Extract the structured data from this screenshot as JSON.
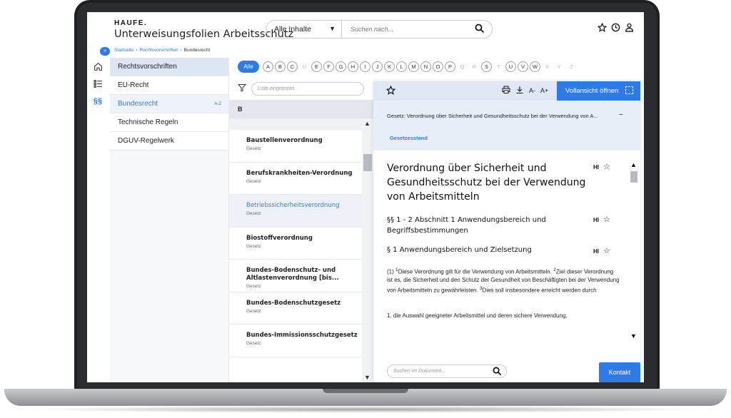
{
  "header": {
    "logo": "HAUFE.",
    "app_title": "Unterweisungsfolien Arbeitsschutz",
    "scope_select": "Alle Inhalte",
    "search_placeholder": "Suchen nach..."
  },
  "breadcrumb": [
    "Startseite",
    "Rechtsvorschriften",
    "Bundesrecht"
  ],
  "nav": {
    "heading": "Rechtsvorschriften",
    "items": [
      {
        "label": "EU-Recht"
      },
      {
        "label": "Bundesrecht",
        "badge": "A-Z"
      },
      {
        "label": "Technische Regeln"
      },
      {
        "label": "DGUV-Regelwerk"
      }
    ]
  },
  "alphabet": {
    "all_label": "Alle",
    "letters": [
      "A",
      "B",
      "C",
      "D",
      "E",
      "F",
      "G",
      "H",
      "I",
      "J",
      "K",
      "L",
      "M",
      "N",
      "O",
      "P",
      "Q",
      "R",
      "S",
      "T",
      "U",
      "V",
      "W",
      "X",
      "Y",
      "Z"
    ],
    "disabled": [
      "D",
      "Q",
      "R",
      "T",
      "X",
      "Y",
      "Z"
    ]
  },
  "list": {
    "filter_placeholder": "Liste eingrenzen",
    "section": "B",
    "laws": [
      {
        "name": "Baustellenverordnung",
        "type": "Gesetz"
      },
      {
        "name": "Berufskrankheiten-Verordnung",
        "type": "Gesetz"
      },
      {
        "name": "Betriebssicherheitsverordnung",
        "type": "Gesetz"
      },
      {
        "name": "Biostoffverordnung",
        "type": "Gesetz"
      },
      {
        "name": "Bundes-Bodenschutz- und Altlastenverordnung [bis...",
        "type": "Gesetz"
      },
      {
        "name": "Bundes-Bodenschutzgesetz",
        "type": "Gesetz"
      },
      {
        "name": "Bundes-Immissionsschutzgesetz",
        "type": "Gesetz"
      }
    ]
  },
  "doc": {
    "full_view_label": "Vollansicht öffnen",
    "font_down": "A-",
    "font_up": "A+",
    "law_line": "Gesetz: Verordnung über Sicherheit und Gesundheitsschutz bei der Verwendung von A...",
    "status_link": "Gesetzesstand",
    "title": "Verordnung über Sicherheit und Gesundheitsschutz bei der Verwendung von Arbeitsmitteln",
    "hi_label": "HI",
    "section1": "§§ 1 - 2 Abschnitt 1 Anwendungsbereich und Begriffsbestimmungen",
    "section2": "§ 1 Anwendungsbereich und Zielsetzung",
    "para_lead": "(1) ",
    "sup1": "1",
    "para_a": "Diese Verordnung gilt für die Verwendung von Arbeitsmitteln. ",
    "sup2": "2",
    "para_b": "Ziel dieser Verordnung ist es, die Sicherheit und den Schutz der Gesundheit von Beschäftigten bei der Verwendung von Arbeitsmitteln zu gewährleisten. ",
    "sup3": "3",
    "para_c": "Dies soll insbesondere erreicht werden durch",
    "para2": "1. die Auswahl geeigneter Arbeitsmittel und deren sichere Verwendung,",
    "search_placeholder": "Suchen im Dokument..."
  },
  "contact_label": "Kontakt",
  "colors": {
    "accent": "#2f7be5",
    "toolbar": "#dfe7f4",
    "nav_head": "#dde6f3"
  }
}
